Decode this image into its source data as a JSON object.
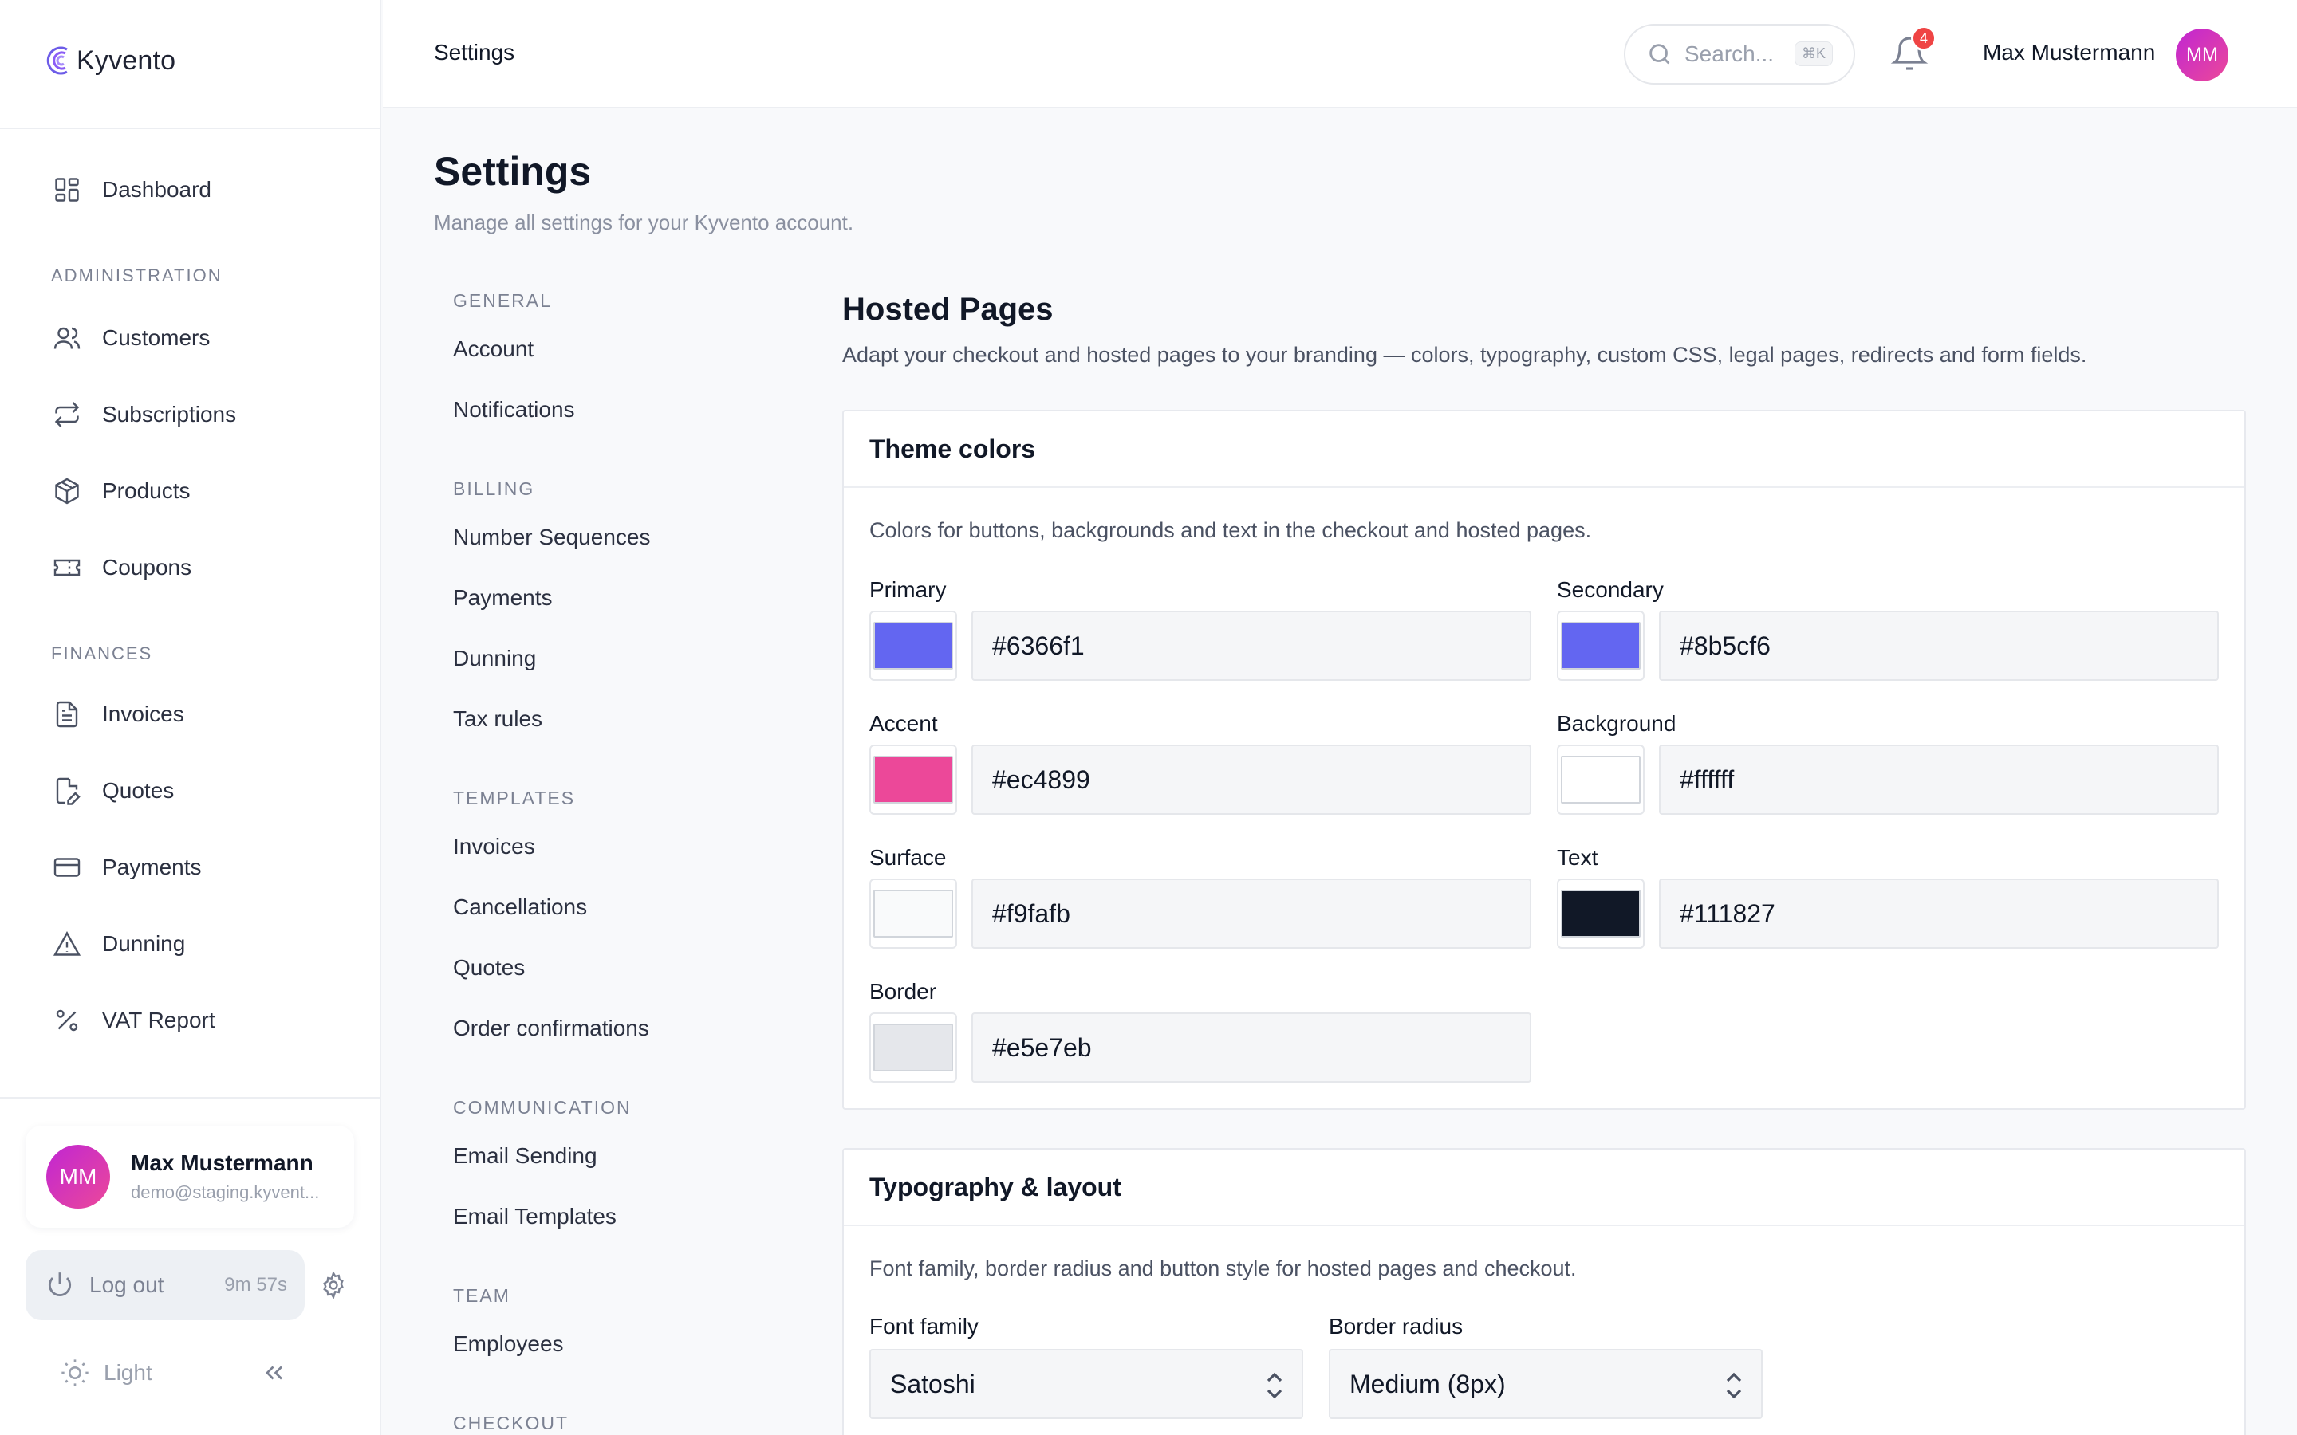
{
  "app": {
    "name": "Kyvento"
  },
  "sidebar": {
    "nav": {
      "dashboard": "Dashboard",
      "administration": "ADMINISTRATION",
      "customers": "Customers",
      "subscriptions": "Subscriptions",
      "products": "Products",
      "coupons": "Coupons",
      "finances": "FINANCES",
      "invoices": "Invoices",
      "quotes": "Quotes",
      "payments": "Payments",
      "dunning": "Dunning",
      "vat_report": "VAT Report"
    },
    "user": {
      "initials": "MM",
      "name": "Max Mustermann",
      "email": "demo@staging.kyvent..."
    },
    "logout": {
      "label": "Log out",
      "timer": "9m 57s"
    },
    "theme": {
      "label": "Light"
    }
  },
  "header": {
    "title": "Settings",
    "search_placeholder": "Search...",
    "search_shortcut": "⌘K",
    "notifications_count": "4",
    "user_name": "Max Mustermann",
    "user_initials": "MM"
  },
  "page": {
    "title": "Settings",
    "subtitle": "Manage all settings for your Kyvento account."
  },
  "settings_nav": {
    "general": "GENERAL",
    "account": "Account",
    "notifications": "Notifications",
    "billing": "BILLING",
    "number_sequences": "Number Sequences",
    "payments": "Payments",
    "dunning": "Dunning",
    "tax_rules": "Tax rules",
    "templates": "TEMPLATES",
    "invoices": "Invoices",
    "cancellations": "Cancellations",
    "quotes": "Quotes",
    "order_confirmations": "Order confirmations",
    "communication": "COMMUNICATION",
    "email_sending": "Email Sending",
    "email_templates": "Email Templates",
    "team": "TEAM",
    "employees": "Employees",
    "checkout": "CHECKOUT"
  },
  "hosted_pages": {
    "title": "Hosted Pages",
    "description": "Adapt your checkout and hosted pages to your branding — colors, typography, custom CSS, legal pages, redirects and form fields.",
    "theme_colors": {
      "title": "Theme colors",
      "description": "Colors for buttons, backgrounds and text in the checkout and hosted pages.",
      "colors": [
        {
          "label": "Primary",
          "value": "#6366f1",
          "swatch": "#6366f1"
        },
        {
          "label": "Secondary",
          "value": "#8b5cf6",
          "swatch": "#6366f1"
        },
        {
          "label": "Accent",
          "value": "#ec4899",
          "swatch": "#ec4899"
        },
        {
          "label": "Background",
          "value": "#ffffff",
          "swatch": "#ffffff"
        },
        {
          "label": "Surface",
          "value": "#f9fafb",
          "swatch": "#f9fafb"
        },
        {
          "label": "Text",
          "value": "#111827",
          "swatch": "#111827"
        },
        {
          "label": "Border",
          "value": "#e5e7eb",
          "swatch": "#e5e7eb"
        }
      ]
    },
    "typography": {
      "title": "Typography & layout",
      "description": "Font family, border radius and button style for hosted pages and checkout.",
      "font_family_label": "Font family",
      "font_family_value": "Satoshi",
      "border_radius_label": "Border radius",
      "border_radius_value": "Medium (8px)"
    }
  },
  "colors": {
    "brand": "#6366f1",
    "avatar_gradient_from": "#c026d3",
    "avatar_gradient_to": "#ec4899",
    "badge": "#ef4444"
  }
}
